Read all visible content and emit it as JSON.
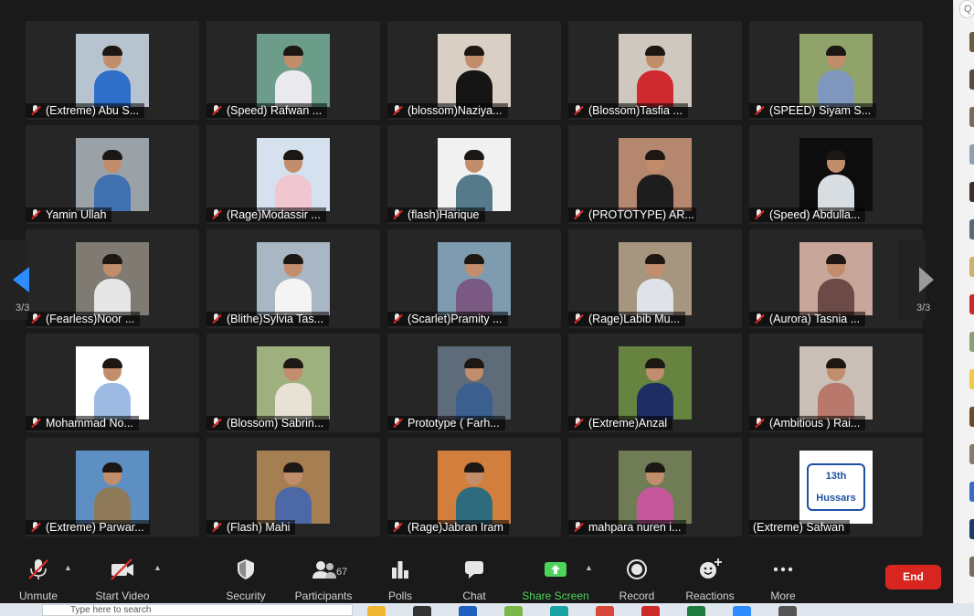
{
  "gallery": {
    "page_indicator_left": "3/3",
    "page_indicator_right": "3/3",
    "participants": [
      {
        "name": "(Extreme) Abu S...",
        "bg": "#b7c4cf",
        "shirt": "#2f6fc9"
      },
      {
        "name": "(Speed) Rafwan ...",
        "bg": "#6c9d8a",
        "shirt": "#e9e9ee"
      },
      {
        "name": "(blossom)Naziya...",
        "bg": "#d9cfc4",
        "shirt": "#151515"
      },
      {
        "name": "(Blossom)Tasfia ...",
        "bg": "#cfc8bf",
        "shirt": "#cf2a2f"
      },
      {
        "name": "(SPEED) Siyam S...",
        "bg": "#8fa36a",
        "shirt": "#7f97bd"
      },
      {
        "name": "Yamin Ullah",
        "bg": "#9aa2a8",
        "shirt": "#3f70b0"
      },
      {
        "name": "(Rage)Modassir ...",
        "bg": "#d6e1ef",
        "shirt": "#f0c6d0"
      },
      {
        "name": "(flash)Harique",
        "bg": "#f1f1f1",
        "shirt": "#557a8a"
      },
      {
        "name": "(PROTOTYPE) AR...",
        "bg": "#b5876e",
        "shirt": "#1d1d1d"
      },
      {
        "name": "(Speed) Abdulla...",
        "bg": "#0d0d0d",
        "shirt": "#d8dde2"
      },
      {
        "name": "(Fearless)Noor  ...",
        "bg": "#7f7b72",
        "shirt": "#e6e6e6"
      },
      {
        "name": "(Blithe)Sylvia Tas...",
        "bg": "#a9b6c4",
        "shirt": "#f4f4f4"
      },
      {
        "name": "(Scarlet)Pramity ...",
        "bg": "#7f9bb0",
        "shirt": "#7a5a83"
      },
      {
        "name": "(Rage)Labib Mu...",
        "bg": "#a7967f",
        "shirt": "#dfe2e9"
      },
      {
        "name": "(Aurora) Tasnia ...",
        "bg": "#c9a69a",
        "shirt": "#6b4a48"
      },
      {
        "name": "Mohammad No...",
        "bg": "#ffffff",
        "shirt": "#9dbbe2"
      },
      {
        "name": "(Blossom) Sabrin...",
        "bg": "#9fb07f",
        "shirt": "#e8e2d6"
      },
      {
        "name": "Prototype ( Farh...",
        "bg": "#5e6b78",
        "shirt": "#3b5f8f"
      },
      {
        "name": "(Extreme)Anzal",
        "bg": "#66843f",
        "shirt": "#1e2d63"
      },
      {
        "name": "(Ambitious ) Rai...",
        "bg": "#c9bfb7",
        "shirt": "#b8796c"
      },
      {
        "name": "(Extreme) Parwar...",
        "bg": "#5d8fc2",
        "shirt": "#8f7a5a"
      },
      {
        "name": "(Flash)  Mahi",
        "bg": "#a57e52",
        "shirt": "#4c68a6"
      },
      {
        "name": "(Rage)Jabran Iram",
        "bg": "#d27f3e",
        "shirt": "#2e6b7d"
      },
      {
        "name": "mahpara nuren i...",
        "bg": "#6f7c55",
        "shirt": "#c6579b"
      },
      {
        "name": "(Extreme) Safwan",
        "bg": "#ffffff",
        "shirt": "#1e4fa3",
        "logo": true,
        "logo_text": "13th Hussars"
      }
    ]
  },
  "toolbar": {
    "unmute_label": "Unmute",
    "start_video_label": "Start Video",
    "security_label": "Security",
    "participants_label": "Participants",
    "participants_count": "67",
    "polls_label": "Polls",
    "chat_label": "Chat",
    "share_screen_label": "Share Screen",
    "record_label": "Record",
    "reactions_label": "Reactions",
    "more_label": "More",
    "end_label": "End",
    "share_color": "#4ed35a",
    "end_color": "#d6261f"
  },
  "sidebar": {
    "search_glyph": "Q",
    "avatar_colors": [
      "#6b5a44",
      "#5a4a3a",
      "#7a6a5b",
      "#8ea0b2",
      "#3a2f2a",
      "#5a6a7a",
      "#d0b070",
      "#c92a2a",
      "#8aa07a",
      "#f2c94c",
      "#6a4a2a",
      "#8a7a6a",
      "#3a6ac9",
      "#1a3a6a",
      "#7a6a5a"
    ]
  },
  "taskbar": {
    "search_placeholder": "Type here to search",
    "app_colors": [
      "#f2b632",
      "#333333",
      "#1f5fbf",
      "#7ab648",
      "#1aa3a3",
      "#d9463b",
      "#cc2a2a",
      "#1e7a3e",
      "#2d8cff",
      "#555555"
    ]
  }
}
